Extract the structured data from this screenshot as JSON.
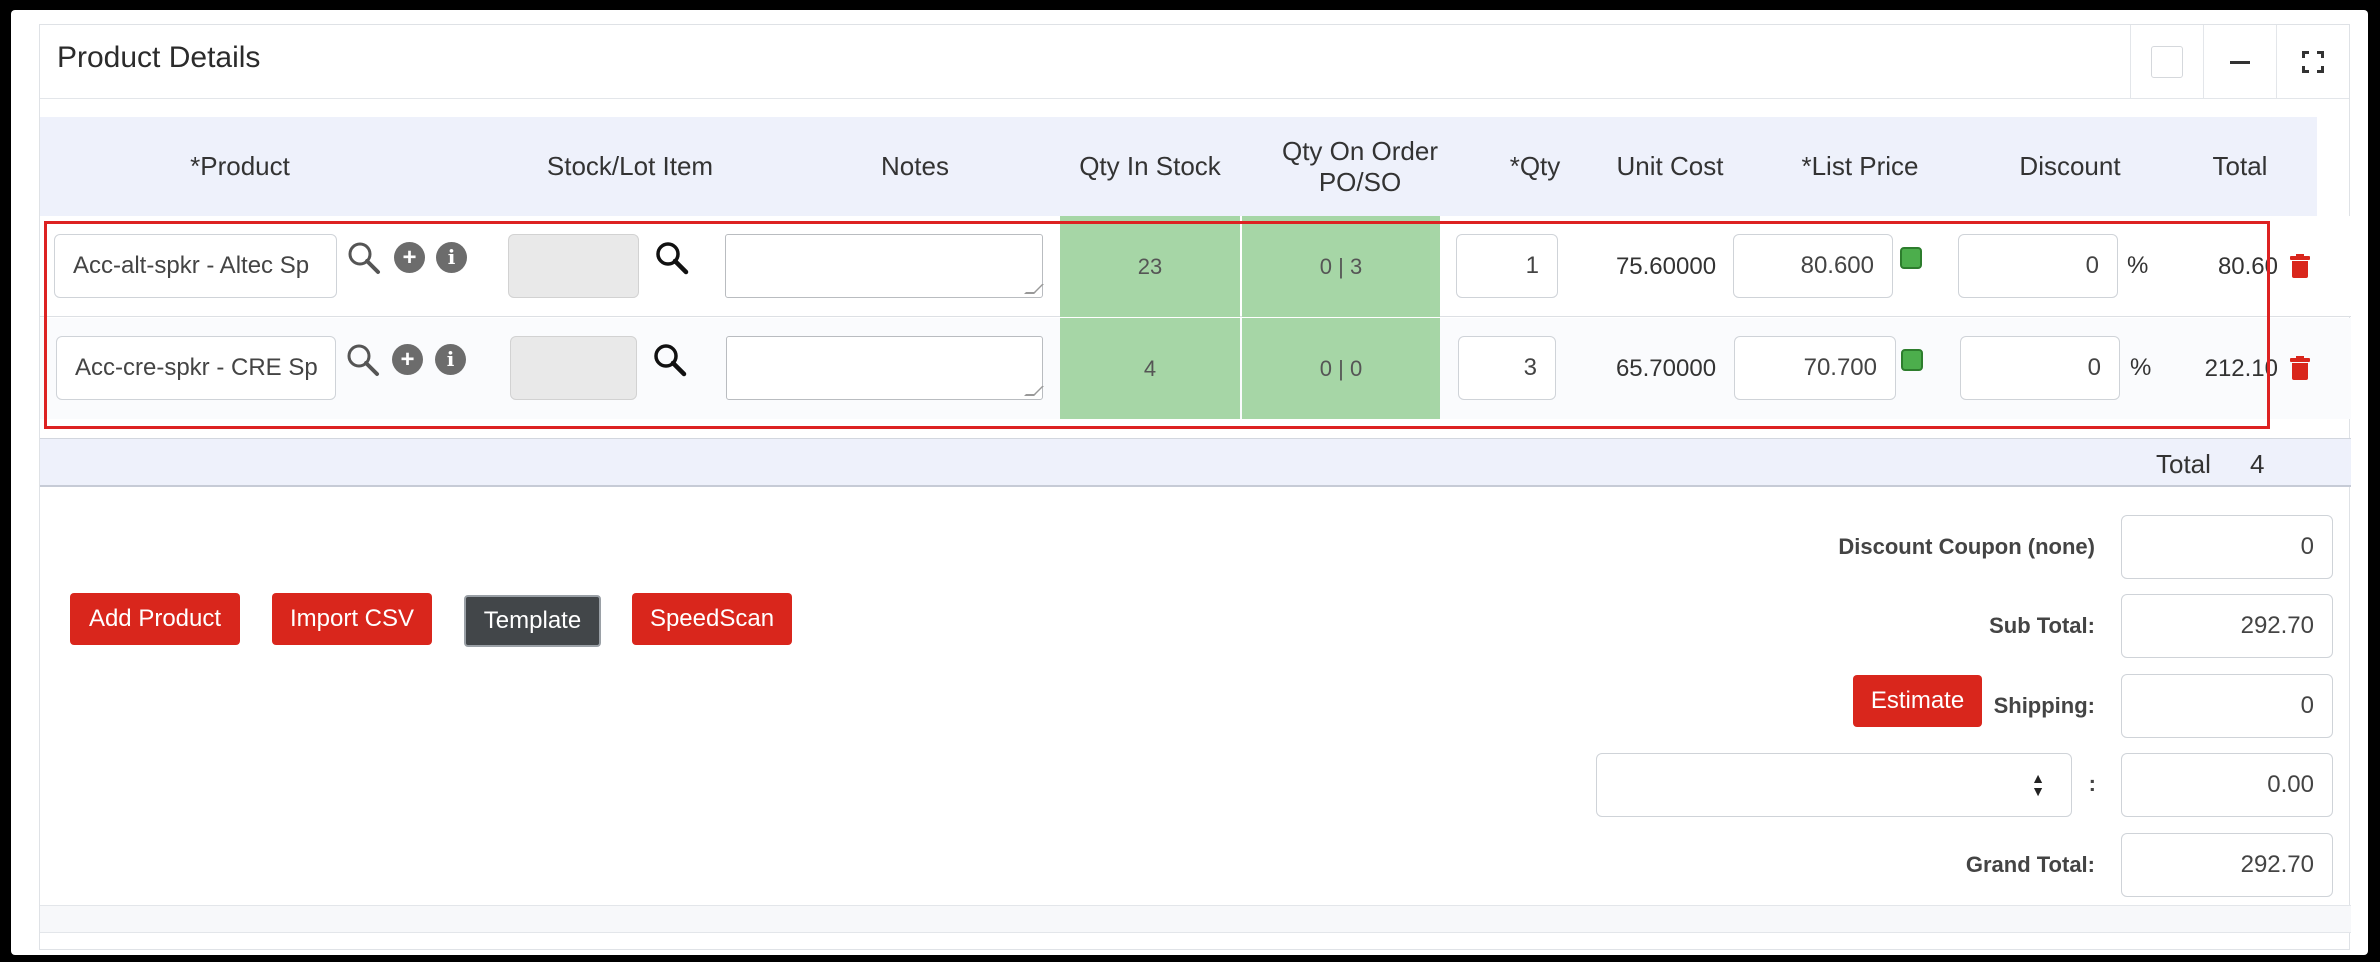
{
  "card": {
    "title": "Product Details"
  },
  "columns": {
    "product": "*Product",
    "stock_lot": "Stock/Lot Item",
    "notes": "Notes",
    "qty_in_stock": "Qty In Stock",
    "qty_on_order": "Qty On Order PO/SO",
    "qty": "*Qty",
    "unit_cost": "Unit Cost",
    "list_price": "*List Price",
    "discount": "Discount",
    "total": "Total"
  },
  "rows": [
    {
      "product": "Acc-alt-spkr - Altec Sp",
      "qty_in_stock": "23",
      "qty_on_order": "0 | 3",
      "qty": "1",
      "unit_cost": "75.60000",
      "list_price": "80.600",
      "discount": "0",
      "discount_unit": "%",
      "total": "80.60"
    },
    {
      "product": "Acc-cre-spkr - CRE Sp",
      "qty_in_stock": "4",
      "qty_on_order": "0 | 0",
      "qty": "3",
      "unit_cost": "65.70000",
      "list_price": "70.700",
      "discount": "0",
      "discount_unit": "%",
      "total": "212.10"
    }
  ],
  "totals_bar": {
    "label": "Total",
    "value": "4"
  },
  "buttons": {
    "add_product": "Add Product",
    "import_csv": "Import CSV",
    "template": "Template",
    "speedscan": "SpeedScan",
    "estimate": "Estimate"
  },
  "summary": {
    "discount_coupon_label": "Discount Coupon (none)",
    "discount_coupon_value": "0",
    "sub_total_label": "Sub Total:",
    "sub_total_value": "292.70",
    "shipping_label": "Shipping:",
    "shipping_value": "0",
    "tax_select_value": "",
    "tax_colon": ":",
    "tax_value": "0.00",
    "grand_total_label": "Grand Total:",
    "grand_total_value": "292.70"
  },
  "colors": {
    "accent_red": "#d9261c",
    "stock_green": "#a6d6a6",
    "header_bg": "#eef1fb"
  }
}
